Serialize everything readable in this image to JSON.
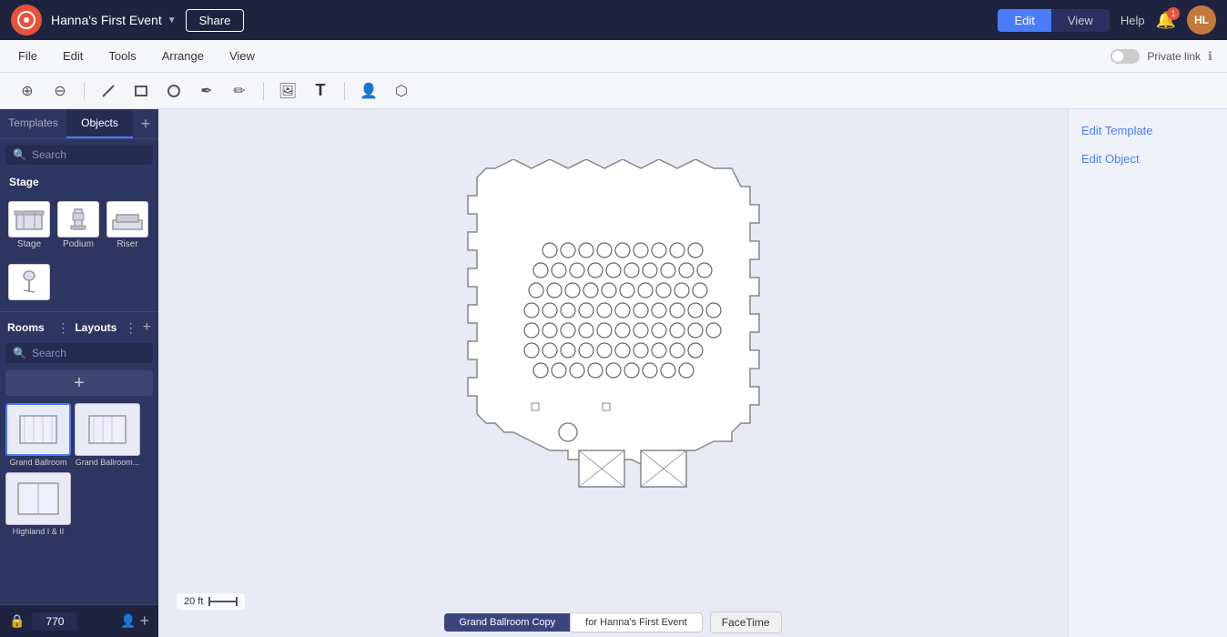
{
  "app": {
    "logo": "⊙",
    "event_name": "Hanna's First Event",
    "share_label": "Share",
    "edit_label": "Edit",
    "view_label": "View",
    "help_label": "Help",
    "notif_count": "1",
    "avatar_initials": "HL"
  },
  "menubar": {
    "items": [
      "File",
      "Edit",
      "Tools",
      "Arrange",
      "View"
    ],
    "private_link_label": "Private link"
  },
  "toolbar": {
    "icons": [
      "zoom-in",
      "zoom-out",
      "line-tool",
      "rectangle-tool",
      "circle-tool",
      "pen-tool",
      "pencil-tool",
      "image-tool",
      "text-tool",
      "people-tool",
      "shapes-tool"
    ]
  },
  "left_panel": {
    "tabs": [
      "Templates",
      "Objects"
    ],
    "active_tab": "Objects",
    "search_placeholder": "Search",
    "section_stage": "Stage",
    "objects": [
      {
        "label": "Stage",
        "icon": "stage"
      },
      {
        "label": "Podium",
        "icon": "podium"
      },
      {
        "label": "Riser",
        "icon": "riser"
      },
      {
        "label": "Mic Stand",
        "icon": "mic"
      }
    ]
  },
  "rooms_section": {
    "rooms_label": "Rooms",
    "layouts_label": "Layouts",
    "search_placeholder": "Search",
    "rooms": [
      {
        "label": "Grand Ballroom",
        "active": true
      },
      {
        "label": "Grand Ballroom...",
        "active": false
      },
      {
        "label": "Highland I & II",
        "active": false
      }
    ]
  },
  "bottom_bar": {
    "room_value": "770"
  },
  "right_panel": {
    "edit_template": "Edit Template",
    "edit_object": "Edit Object"
  },
  "status_bar": {
    "chip1": "Grand Ballroom Copy",
    "chip2": "for Hanna's First Event",
    "tooltip": "FaceTime"
  },
  "scale": {
    "label": "20 ft"
  },
  "colors": {
    "accent": "#4a7cfc",
    "dark_bg": "#1e2340",
    "panel_bg": "#2d3561",
    "canvas_bg": "#d8daf0"
  }
}
